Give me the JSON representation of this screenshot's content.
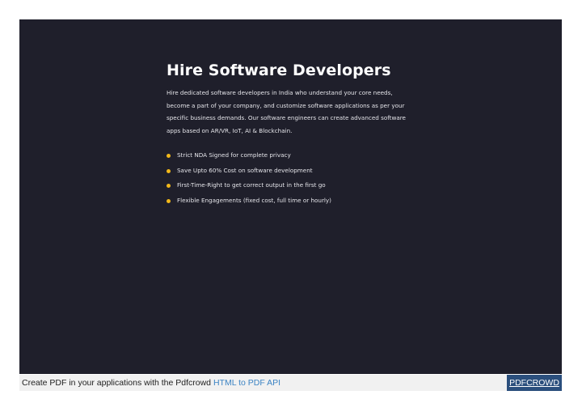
{
  "hero": {
    "title": "Hire Software Developers",
    "description": "Hire dedicated software developers in India who understand your core needs, become a part of your company, and customize software applications as per your specific business demands. Our software engineers can create advanced software apps based on AR/VR, IoT, AI & Blockchain.",
    "bullets": [
      "Strict NDA Signed for complete privacy",
      "Save Upto 60% Cost on software development",
      "First-Time-Right to get correct output in the first go",
      "Flexible Engagements (fixed cost, full time or hourly)"
    ]
  },
  "footer": {
    "text": "Create PDF in your applications with the Pdfcrowd ",
    "link_text": "HTML to PDF API",
    "brand": "PDFCROWD"
  },
  "colors": {
    "hero_background": "#1f1f2b",
    "bullet_accent": "#f2b81a",
    "footer_link": "#3c84c4",
    "brand_background": "#2b4f7d"
  }
}
